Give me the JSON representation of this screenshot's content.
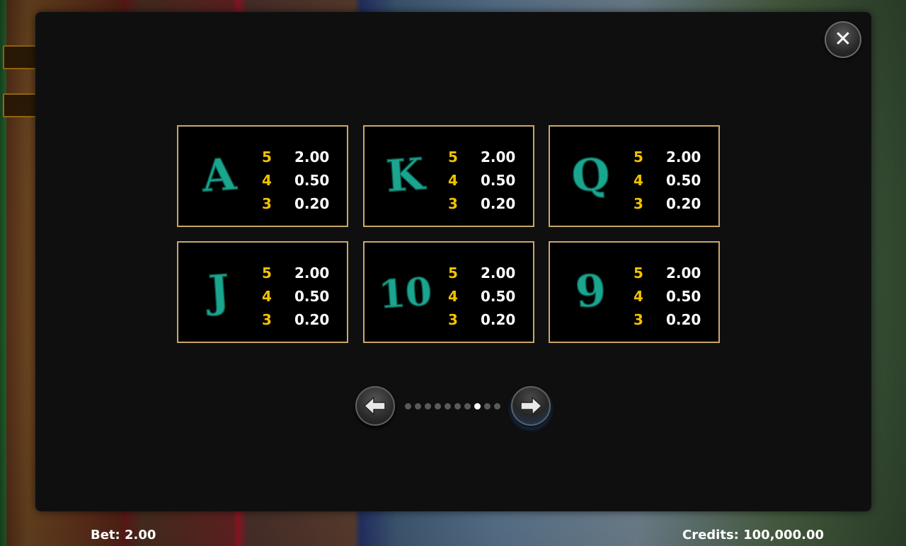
{
  "modal": {
    "close_label": "✕"
  },
  "paytable": [
    {
      "symbol": "A",
      "pays": [
        {
          "count": "5",
          "value": "2.00"
        },
        {
          "count": "4",
          "value": "0.50"
        },
        {
          "count": "3",
          "value": "0.20"
        }
      ]
    },
    {
      "symbol": "K",
      "pays": [
        {
          "count": "5",
          "value": "2.00"
        },
        {
          "count": "4",
          "value": "0.50"
        },
        {
          "count": "3",
          "value": "0.20"
        }
      ]
    },
    {
      "symbol": "Q",
      "pays": [
        {
          "count": "5",
          "value": "2.00"
        },
        {
          "count": "4",
          "value": "0.50"
        },
        {
          "count": "3",
          "value": "0.20"
        }
      ]
    },
    {
      "symbol": "J",
      "pays": [
        {
          "count": "5",
          "value": "2.00"
        },
        {
          "count": "4",
          "value": "0.50"
        },
        {
          "count": "3",
          "value": "0.20"
        }
      ]
    },
    {
      "symbol": "10",
      "pays": [
        {
          "count": "5",
          "value": "2.00"
        },
        {
          "count": "4",
          "value": "0.50"
        },
        {
          "count": "3",
          "value": "0.20"
        }
      ]
    },
    {
      "symbol": "9",
      "pays": [
        {
          "count": "5",
          "value": "2.00"
        },
        {
          "count": "4",
          "value": "0.50"
        },
        {
          "count": "3",
          "value": "0.20"
        }
      ]
    }
  ],
  "pagination": {
    "total_pages": 10,
    "current_page": 8
  },
  "colors": {
    "symbol": "#1aa58f",
    "count": "#f2c200",
    "value": "#ffffff",
    "card_border": "#c9a76a"
  },
  "icons": {
    "close": "close-icon",
    "prev": "arrow-left-icon",
    "next": "arrow-right-icon"
  },
  "footer": {
    "bet": "Bet: 2.00",
    "credits": "Credits: 100,000.00"
  }
}
